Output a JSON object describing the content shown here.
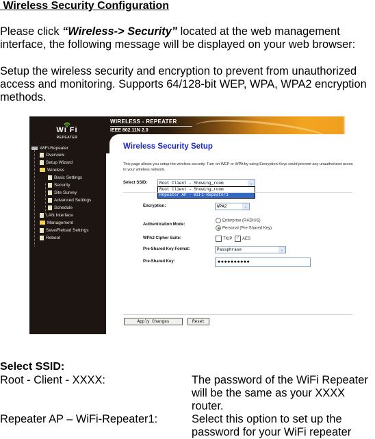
{
  "document": {
    "title": " Wireless Security Configuration",
    "para1_prefix": "Please click ",
    "para1_bold": "“Wireless-> Security”",
    "para1_suffix": " located at the web management interface, the following message will be displayed on your web browser:",
    "para2": "Setup the wireless security and encryption to prevent from unauthorized access and monitoring. Supports 64/128-bit WEP, WPA, WPA2 encryption methods.",
    "section_title": "Select SSID:",
    "definitions": [
      {
        "term": "Root - Client - XXXX:",
        "description": "The password of the WiFi Repeater will be the same as your XXXX router."
      },
      {
        "term": "Repeater AP – WiFi-Repeater1:",
        "description": "Select this option to set up the password for your WiFi repeater"
      }
    ]
  },
  "screenshot": {
    "logo": {
      "wifi": "Wi  Fi",
      "sub": "REPEATER"
    },
    "header": {
      "line1": "WIRELESS - REPEATER",
      "line2": "IEEE 802.11N 2.0"
    },
    "tree": [
      {
        "label": "WiFi-Repeater",
        "icon": "computer-icon"
      },
      {
        "label": "Overview",
        "icon": "page-icon"
      },
      {
        "label": "Setup Wizard",
        "icon": "page-icon"
      },
      {
        "label": "Wireless",
        "icon": "folder-open-icon"
      },
      {
        "label": "Basic Settings",
        "icon": "page-icon"
      },
      {
        "label": "Security",
        "icon": "page-icon"
      },
      {
        "label": "Site Survey",
        "icon": "page-icon"
      },
      {
        "label": "Advanced Settings",
        "icon": "page-icon"
      },
      {
        "label": "Schedule",
        "icon": "page-icon"
      },
      {
        "label": "LAN Interface",
        "icon": "page-icon"
      },
      {
        "label": "Management",
        "icon": "folder-icon"
      },
      {
        "label": "Save/Reload Settings",
        "icon": "page-icon"
      },
      {
        "label": "Reboot",
        "icon": "page-icon"
      }
    ],
    "page_title": "Wireless Security Setup",
    "description": "This page allows you setup the wireless security. Turn on WEP or WPA by using Encryption Keys could prevent any unauthorized access to your wireless network.",
    "select_ssid": {
      "label": "Select SSID:",
      "value": "Root Client - Showing_room",
      "options": [
        "Root Client - Showing_room",
        "Repeater AP - WiFi-Repeater1"
      ],
      "highlighted": "Repeater AP - WiFi-Repeater1"
    },
    "encryption": {
      "label": "Encryption:",
      "value": "WPA2"
    },
    "auth_mode": {
      "label": "Authentication Mode:",
      "options": [
        {
          "label": "Enterprise (RADIUS)",
          "selected": false
        },
        {
          "label": "Personal (Pre-Shared Key)",
          "selected": true
        }
      ]
    },
    "cipher_suite": {
      "label": "WPA2 Cipher Suite:",
      "options": [
        {
          "label": "TKIP",
          "checked": false
        },
        {
          "label": "AES",
          "checked": true
        }
      ]
    },
    "psk_format": {
      "label": "Pre-Shared Key Format:",
      "value": "Passphrase"
    },
    "psk": {
      "label": "Pre-Shared Key:",
      "value": "●●●●●●●●●●"
    },
    "buttons": {
      "apply": "Apply Changes",
      "reset": "Reset"
    },
    "colors": {
      "title_blue": "#1c25c8",
      "sidebar_bg": "#1c1511",
      "header_orange": "#f3a41f",
      "highlight": "#3167c6"
    }
  }
}
